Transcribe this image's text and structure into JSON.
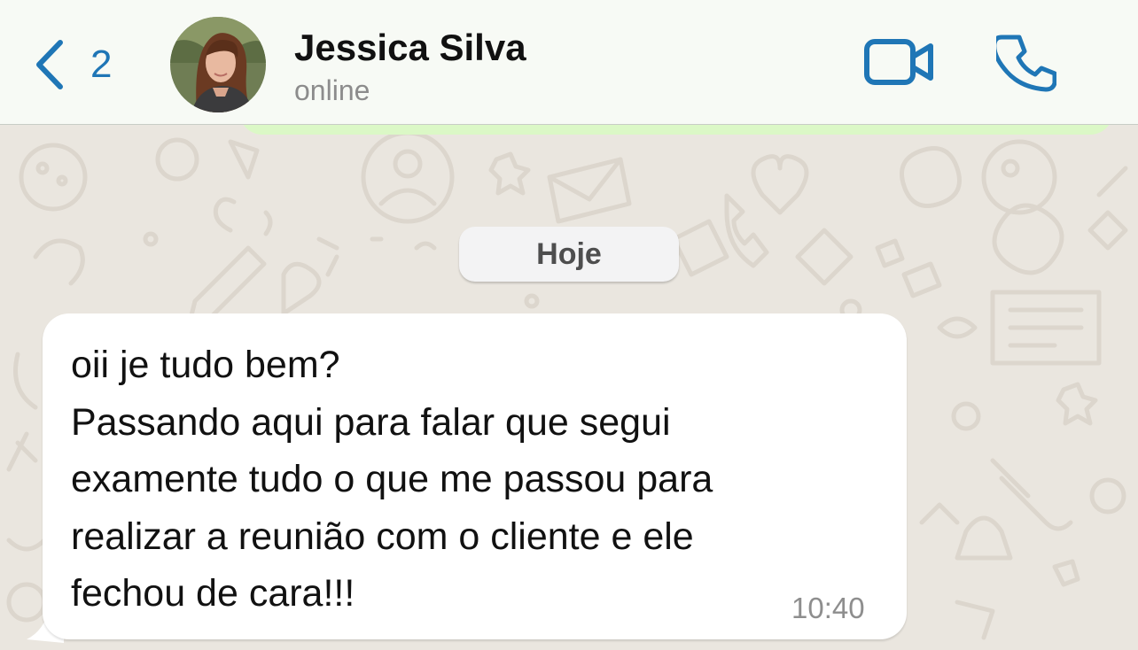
{
  "header": {
    "back_count": "2",
    "contact_name": "Jessica Silva",
    "contact_status": "online",
    "accent_color": "#1f76b6"
  },
  "chat": {
    "date_label": "Hoje",
    "messages": [
      {
        "direction": "incoming",
        "lines": [
          "oii je tudo bem?",
          "Passando aqui para falar que segui",
          "examente tudo o que me passou para",
          "realizar a reunião com o cliente e ele",
          "fechou de cara!!!"
        ],
        "time": "10:40"
      }
    ]
  },
  "icons": {
    "back": "chevron-left-icon",
    "video": "video-camera-icon",
    "call": "phone-icon"
  }
}
